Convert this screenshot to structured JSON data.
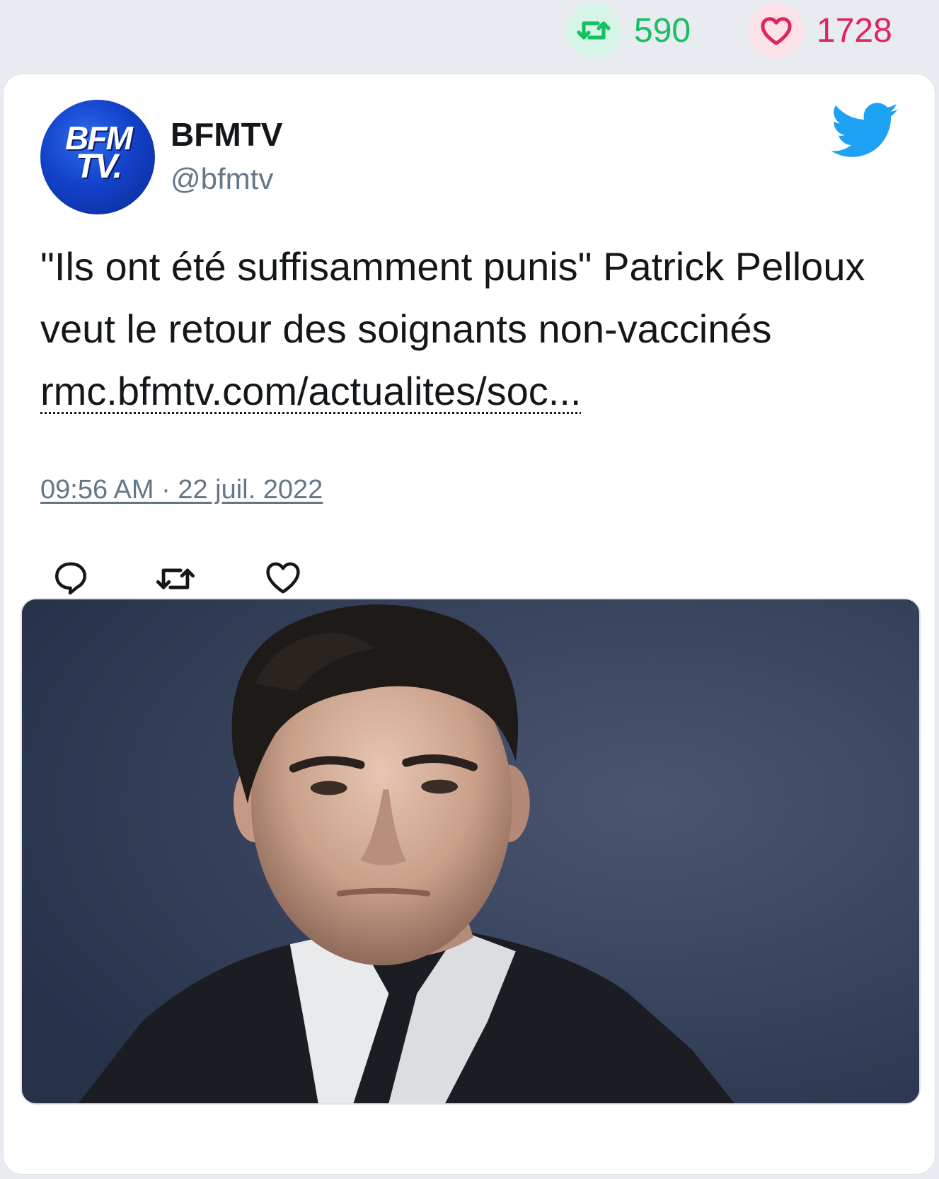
{
  "stats": {
    "retweets": "590",
    "likes": "1728",
    "retweet_icon": "retweet-icon",
    "like_icon": "heart-icon",
    "retweet_color": "#17bf63",
    "like_color": "#e0245e"
  },
  "author": {
    "name": "BFMTV",
    "handle": "@bfmtv",
    "avatar_logo_line1": "BFM",
    "avatar_logo_line2": "TV.",
    "avatar_color": "#1342c9"
  },
  "tweet": {
    "text": "\"Ils ont été suffisamment punis\" Patrick Pelloux veut le retour des soignants non-vaccinés ",
    "link": "rmc.bfmtv.com/actualites/soc...",
    "timestamp": "09:56 AM · 22 juil. 2022"
  },
  "actions": {
    "reply_icon": "reply-icon",
    "retweet_icon": "retweet-icon",
    "like_icon": "heart-icon"
  },
  "brand": {
    "icon": "twitter-bird-icon",
    "color": "#1da1f2"
  }
}
